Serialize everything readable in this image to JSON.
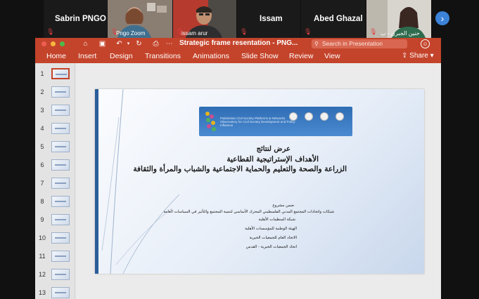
{
  "participants": [
    {
      "name": "Sabrin PNGO",
      "caption": ""
    },
    {
      "name": "",
      "caption": "Pngo Zoom"
    },
    {
      "name": "",
      "caption": "issam arur"
    },
    {
      "name": "Issam",
      "caption": ""
    },
    {
      "name": "Abed Ghazal",
      "caption": ""
    },
    {
      "name": "",
      "caption": "حنين الجبري - ب"
    }
  ],
  "app": {
    "title": "Strategic frame resentation - PNG...",
    "search_placeholder": "Search in Presentation",
    "share_label": "Share",
    "accent_color": "#c4442b",
    "tabs": [
      "Home",
      "Insert",
      "Design",
      "Transitions",
      "Animations",
      "Slide Show",
      "Review",
      "View"
    ]
  },
  "slides": {
    "numbers": [
      "1",
      "2",
      "3",
      "4",
      "5",
      "6",
      "7",
      "8",
      "9",
      "10",
      "11",
      "12",
      "13"
    ],
    "selected": "1"
  },
  "slide": {
    "banner_text": "Palestinian Civil Society Platforms & Networks Observatory for Civil Society Development and Policy Influence",
    "title_lines": [
      "عرض لنتائج",
      "الأهداف الإستراتيجية القطاعية",
      "الزراعة والصحة والتعليم والحماية الاجتماعية والشباب والمرأة والثقافة"
    ],
    "body_lines": [
      "ضمن مشروع",
      "شبكات واتحادات المجتمع المدني الفلسطيني المحرك الأساسي لتنمية المجتمع والتأثير في السياسات العامة",
      "شبكة المنظمات الأهلية",
      "الهيئة الوطنية للمؤسسات الأهلية",
      "الاتحاد العام للجمعيات الخيرية",
      "اتحاد الجمعيات الخيرية - القدس"
    ]
  }
}
